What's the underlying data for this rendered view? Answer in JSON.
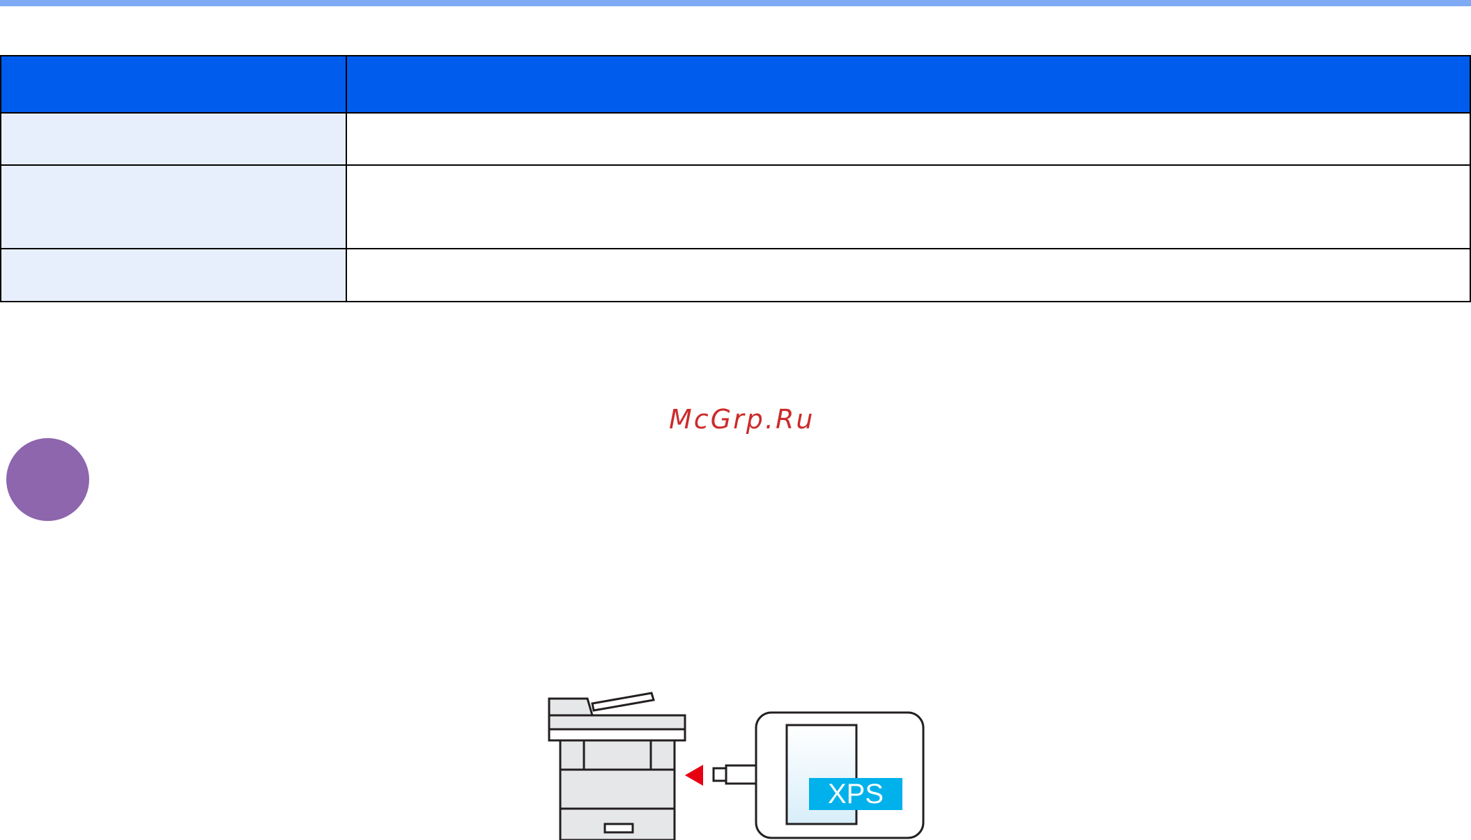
{
  "header_rule": {
    "color": "#7eaaf4"
  },
  "table": {
    "header_color": "#005ced",
    "label_cell_color": "#e7effc",
    "columns": [
      "",
      ""
    ],
    "rows": [
      {
        "label": "",
        "value": ""
      },
      {
        "label": "",
        "value": ""
      },
      {
        "label": "",
        "value": ""
      }
    ]
  },
  "watermark": {
    "text": "McGrp.Ru",
    "color": "#cc2b2b"
  },
  "step_marker": {
    "color": "#8d66ad"
  },
  "illustration": {
    "file_badge": "XPS",
    "badge_color": "#00b1eb",
    "arrow_color": "#e60012",
    "icons": [
      "printer-icon",
      "insert-arrow-icon",
      "usb-drive-icon",
      "xps-document-icon"
    ]
  }
}
